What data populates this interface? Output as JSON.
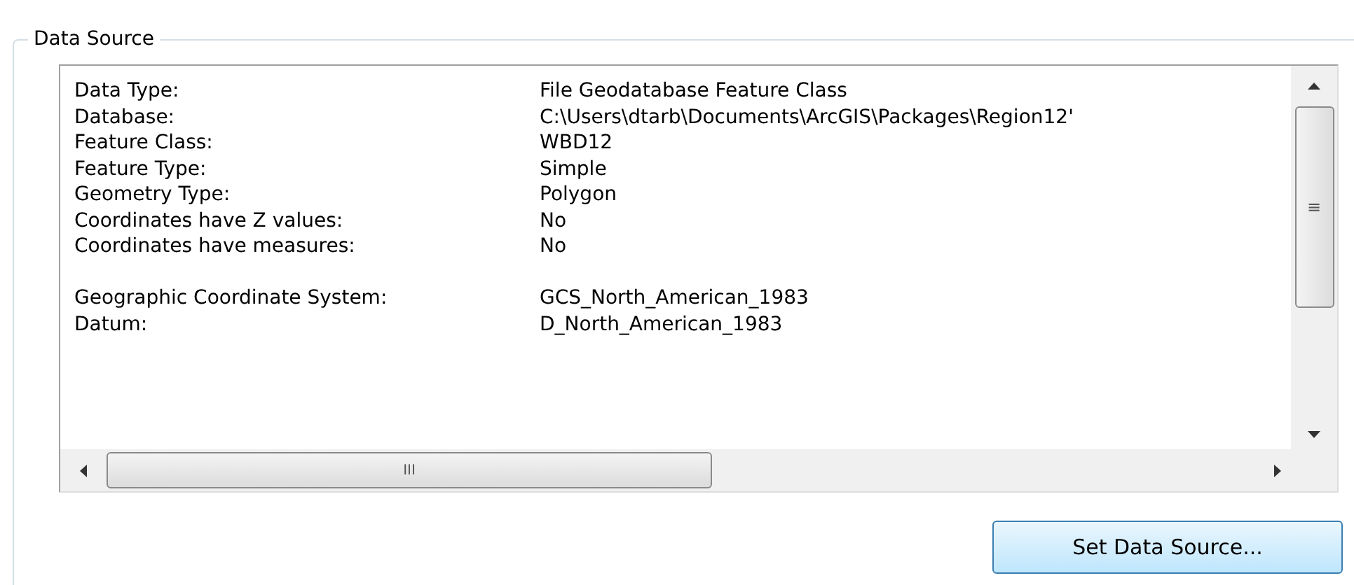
{
  "group": {
    "title": "Data Source"
  },
  "sections": [
    [
      {
        "label": "Data Type:",
        "value": "File Geodatabase Feature Class"
      },
      {
        "label": "Database:",
        "value": "C:\\Users\\dtarb\\Documents\\ArcGIS\\Packages\\Region12'"
      },
      {
        "label": "Feature Class:",
        "value": "WBD12"
      },
      {
        "label": "Feature Type:",
        "value": "Simple"
      },
      {
        "label": "Geometry Type:",
        "value": "Polygon"
      },
      {
        "label": "Coordinates have Z values:",
        "value": "No"
      },
      {
        "label": "Coordinates have measures:",
        "value": "No"
      }
    ],
    [
      {
        "label": "Geographic Coordinate System:",
        "value": "GCS_North_American_1983"
      },
      {
        "label": "Datum:",
        "value": "D_North_American_1983"
      }
    ]
  ],
  "scrollbar_grip": "≡",
  "hscroll_grip": "III",
  "buttons": [
    "Set Data Source..."
  ]
}
